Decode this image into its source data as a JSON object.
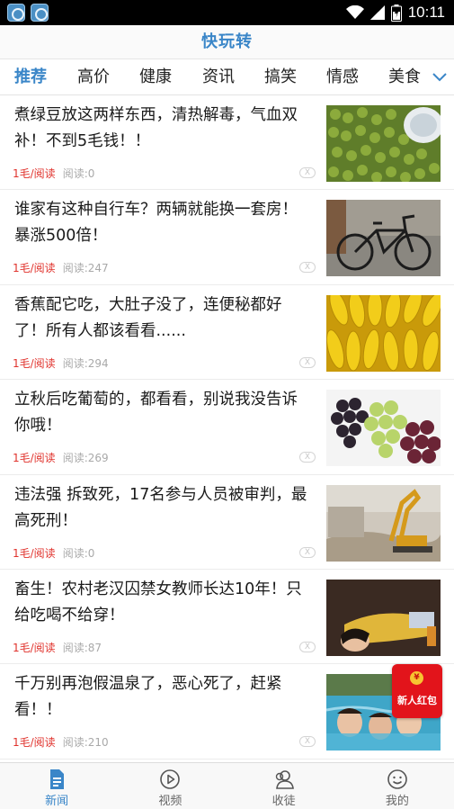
{
  "status_bar": {
    "time": "10:11"
  },
  "app": {
    "title": "快玩转"
  },
  "tabs": [
    {
      "label": "推荐",
      "active": true
    },
    {
      "label": "高价"
    },
    {
      "label": "健康"
    },
    {
      "label": "资讯"
    },
    {
      "label": "搞笑"
    },
    {
      "label": "情感"
    },
    {
      "label": "美食"
    }
  ],
  "feed": [
    {
      "title": "煮绿豆放这两样东西，清热解毒，气血双补！不到5毛钱！！",
      "price": "1毛/阅读",
      "reads": "阅读:0",
      "image": "green-beans"
    },
    {
      "title": "谁家有这种自行车？两辆就能换一套房！暴涨500倍！",
      "price": "1毛/阅读",
      "reads": "阅读:247",
      "image": "bicycle"
    },
    {
      "title": "香蕉配它吃，大肚子没了，连便秘都好了！所有人都该看看......",
      "price": "1毛/阅读",
      "reads": "阅读:294",
      "image": "bananas"
    },
    {
      "title": "立秋后吃葡萄的，都看看，别说我没告诉你哦！",
      "price": "1毛/阅读",
      "reads": "阅读:269",
      "image": "grapes"
    },
    {
      "title": "违法强 拆致死，17名参与人员被审判，最高死刑！",
      "price": "1毛/阅读",
      "reads": "阅读:0",
      "image": "excavator"
    },
    {
      "title": "畜生！农村老汉囚禁女教师长达10年！只给吃喝不给穿！",
      "price": "1毛/阅读",
      "reads": "阅读:87",
      "image": "woman-lying"
    },
    {
      "title": "千万别再泡假温泉了，恶心死了，赶紧看！！",
      "price": "1毛/阅读",
      "reads": "阅读:210",
      "image": "hot-spring"
    }
  ],
  "red_packet": {
    "label": "新人红包",
    "coin": "¥"
  },
  "bottom_nav": [
    {
      "label": "新闻",
      "icon": "news-icon",
      "active": true
    },
    {
      "label": "视频",
      "icon": "video-icon"
    },
    {
      "label": "收徒",
      "icon": "apprentice-icon"
    },
    {
      "label": "我的",
      "icon": "profile-icon"
    }
  ],
  "colors": {
    "accent": "#3a86c8",
    "price": "#e0322c",
    "red_packet": "#e2141b"
  }
}
